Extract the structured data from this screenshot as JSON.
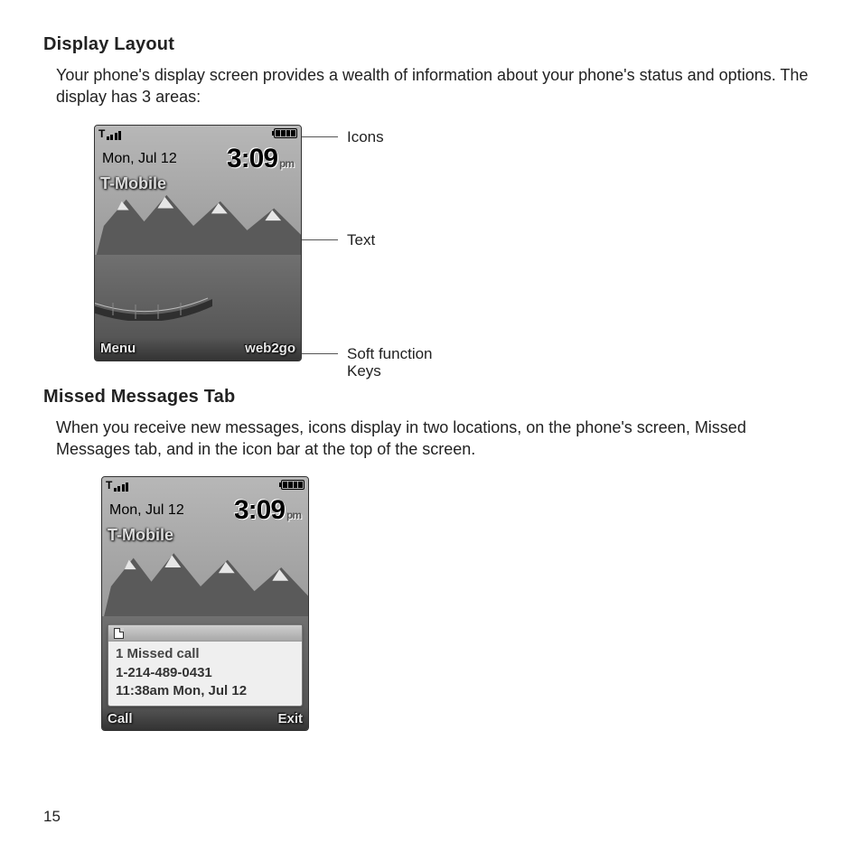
{
  "section1": {
    "heading": "Display Layout",
    "paragraph": "Your phone's display screen provides a wealth of information about your phone's status and options. The display has 3 areas:"
  },
  "phone": {
    "date": "Mon, Jul 12",
    "time": "3:09",
    "ampm": "pm",
    "carrier": "T-Mobile",
    "softkeys": {
      "left": "Menu",
      "right": "web2go"
    }
  },
  "annotations": {
    "icons": "Icons",
    "text": "Text",
    "softkeys_line1": "Soft function",
    "softkeys_line2": "Keys"
  },
  "section2": {
    "heading": "Missed Messages Tab",
    "paragraph": "When you receive new messages, icons display in two locations, on the phone's screen, Missed Messages tab, and in the icon bar at the top of the screen."
  },
  "notification": {
    "title": "1 Missed call",
    "number": "1-214-489-0431",
    "timestamp": "11:38am Mon, Jul 12",
    "softkeys": {
      "left": "Call",
      "right": "Exit"
    }
  },
  "page_number": "15"
}
